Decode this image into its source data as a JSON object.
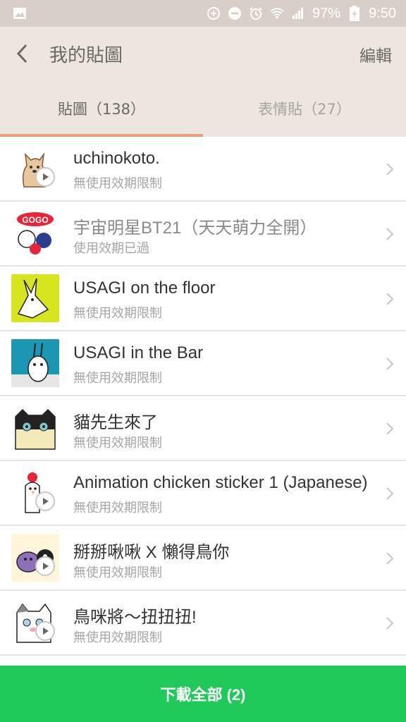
{
  "status_bar": {
    "battery": "97%",
    "time": "9:50",
    "icons": [
      "image-icon",
      "data-saver-icon",
      "do-not-disturb-icon",
      "alarm-icon",
      "wifi-icon",
      "signal-icon",
      "battery-charging-icon"
    ]
  },
  "header": {
    "title": "我的貼圖",
    "edit_label": "編輯",
    "back_icon": "back-arrow-icon"
  },
  "tabs": [
    {
      "label": "貼圖（138）",
      "active": true
    },
    {
      "label": "表情貼（27）",
      "active": false
    }
  ],
  "colors": {
    "accent": "#e9a07f",
    "button": "#1fc95a",
    "header_bg": "#ece6df"
  },
  "items": [
    {
      "title": "uchinokoto.",
      "subtitle": "無使用效期限制",
      "animated": true,
      "expired": false,
      "thumb": "dog-sticker-icon"
    },
    {
      "title": "宇宙明星BT21（天天萌力全開）",
      "subtitle": "使用效期已過",
      "animated": false,
      "expired": true,
      "thumb": "bt21-sticker-icon"
    },
    {
      "title": "USAGI on the floor",
      "subtitle": "無使用效期限制",
      "animated": false,
      "expired": false,
      "thumb": "rabbit-floor-sticker-icon"
    },
    {
      "title": "USAGI in the Bar",
      "subtitle": "無使用效期限制",
      "animated": false,
      "expired": false,
      "thumb": "rabbit-bar-sticker-icon"
    },
    {
      "title": "貓先生來了",
      "subtitle": "無使用效期限制",
      "animated": false,
      "expired": false,
      "thumb": "cat-sticker-icon"
    },
    {
      "title": "Animation chicken sticker 1 (Japanese)",
      "subtitle": "無使用效期限制",
      "animated": true,
      "expired": false,
      "thumb": "chicken-sticker-icon"
    },
    {
      "title": "掰掰啾啾 X 懶得鳥你",
      "subtitle": "無使用效期限制",
      "animated": true,
      "expired": false,
      "thumb": "bird-sticker-icon"
    },
    {
      "title": "鳥咪將～扭扭扭!",
      "subtitle": "無使用效期限制",
      "animated": true,
      "expired": false,
      "thumb": "cat-bird-sticker-icon"
    }
  ],
  "download_button": {
    "label": "下載全部 (2)"
  }
}
